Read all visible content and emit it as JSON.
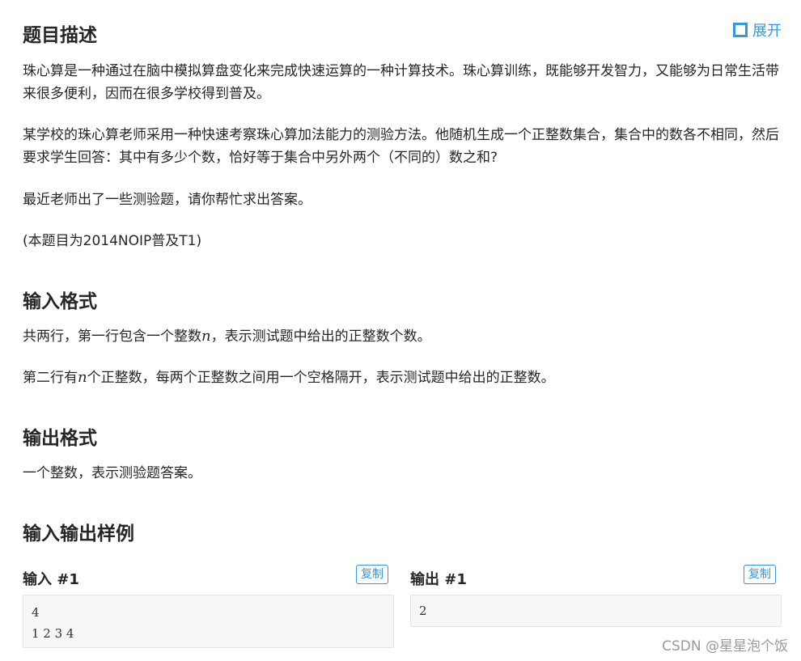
{
  "description": {
    "title": "题目描述",
    "expand_label": "展开",
    "p1": "珠心算是一种通过在脑中模拟算盘变化来完成快速运算的一种计算技术。珠心算训练，既能够开发智力，又能够为日常生活带来很多便利，因而在很多学校得到普及。",
    "p2": "某学校的珠心算老师采用一种快速考察珠心算加法能力的测验方法。他随机生成一个正整数集合，集合中的数各不相同，然后要求学生回答：其中有多少个数，恰好等于集合中另外两个（不同的）数之和?",
    "p3": "最近老师出了一些测验题，请你帮忙求出答案。",
    "p4": "(本题目为2014NOIP普及T1)"
  },
  "input_format": {
    "title": "输入格式",
    "line1_before": "共两行，第一行包含一个整数",
    "line1_var": "n",
    "line1_after": "，表示测试题中给出的正整数个数。",
    "line2_before": "第二行有",
    "line2_var": "n",
    "line2_after": "个正整数，每两个正整数之间用一个空格隔开，表示测试题中给出的正整数。"
  },
  "output_format": {
    "title": "输出格式",
    "line1": "一个整数，表示测验题答案。"
  },
  "samples": {
    "title": "输入输出样例",
    "input_label": "输入 #1",
    "output_label": "输出 #1",
    "copy_label": "复制",
    "input_text": "4\n1 2 3 4",
    "output_text": "2"
  },
  "watermark": "CSDN @星星泡个饭"
}
